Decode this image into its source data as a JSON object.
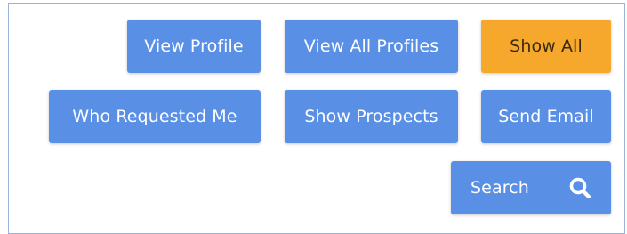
{
  "buttons": {
    "view_profile": "View Profile",
    "view_all_profiles": "View All Profiles",
    "show_all": "Show All",
    "who_requested_me": "Who Requested Me",
    "show_prospects": "Show Prospects",
    "send_email": "Send Email",
    "search": "Search"
  },
  "icons": {
    "search": "search-icon"
  },
  "colors": {
    "primary_button": "#5a8fe6",
    "accent_button": "#f6a82c",
    "border": "#9bb4da"
  }
}
